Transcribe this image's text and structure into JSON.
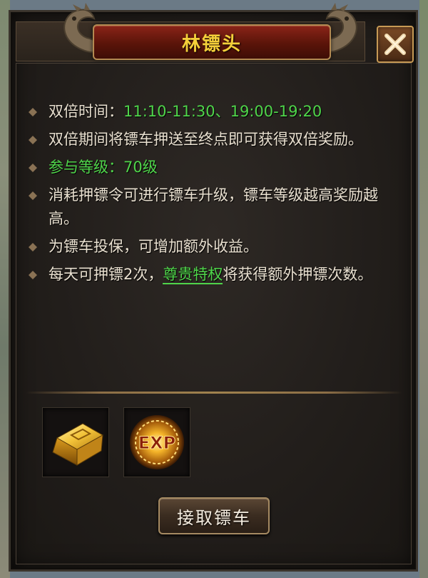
{
  "dialog": {
    "title": "林镖头",
    "close_icon": "close-x-icon"
  },
  "info": {
    "double_time_label": "双倍时间：",
    "double_time_value": "11:10-11:30、19:00-19:20",
    "double_reward_line": "双倍期间将镖车押送至终点即可获得双倍奖励。",
    "level_requirement": "参与等级：70级",
    "upgrade_line": "消耗押镖令可进行镖车升级，镖车等级越高奖励越高。",
    "insure_line": "为镖车投保，可增加额外收益。",
    "daily_prefix": "每天可押镖2次，",
    "privilege_link": "尊贵特权",
    "daily_suffix": "将获得额外押镖次数。"
  },
  "rewards": [
    {
      "icon": "gold-ingot-icon"
    },
    {
      "icon": "exp-orb-icon",
      "label": "EXP"
    }
  ],
  "actions": {
    "accept_label": "接取镖车"
  },
  "colors": {
    "title_gold": "#f4cf3a",
    "highlight_green": "#4fd44a",
    "body_text": "#e9e0d0",
    "panel_bg": "#221e1b",
    "title_plate_red": "#8a2418"
  }
}
